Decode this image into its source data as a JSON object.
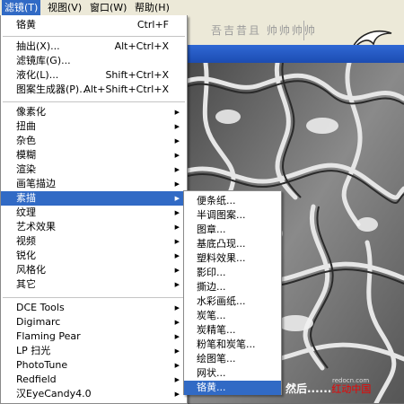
{
  "menubar": {
    "items": [
      {
        "label": "滤镜(T)",
        "active": true
      },
      {
        "label": "视图(V)",
        "active": false
      },
      {
        "label": "窗口(W)",
        "active": false
      },
      {
        "label": "帮助(H)",
        "active": false
      }
    ]
  },
  "toolbar": {
    "glyphs": "吾吉昔且 帅帅帅帅"
  },
  "filter_menu": {
    "top": [
      {
        "label": "铬黄",
        "shortcut": "Ctrl+F"
      }
    ],
    "group1": [
      {
        "label": "抽出(X)...",
        "shortcut": "Alt+Ctrl+X"
      },
      {
        "label": "滤镜库(G)...",
        "shortcut": ""
      },
      {
        "label": "液化(L)...",
        "shortcut": "Shift+Ctrl+X"
      },
      {
        "label": "图案生成器(P)...",
        "shortcut": "Alt+Shift+Ctrl+X"
      }
    ],
    "group2": [
      {
        "label": "像素化"
      },
      {
        "label": "扭曲"
      },
      {
        "label": "杂色"
      },
      {
        "label": "模糊"
      },
      {
        "label": "渲染"
      },
      {
        "label": "画笔描边"
      },
      {
        "label": "素描",
        "highlighted": true
      },
      {
        "label": "纹理"
      },
      {
        "label": "艺术效果"
      },
      {
        "label": "视频"
      },
      {
        "label": "锐化"
      },
      {
        "label": "风格化"
      },
      {
        "label": "其它"
      }
    ],
    "group3": [
      {
        "label": "DCE Tools"
      },
      {
        "label": "Digimarc"
      },
      {
        "label": "Flaming Pear"
      },
      {
        "label": "LP 扫光"
      },
      {
        "label": "PhotoTune"
      },
      {
        "label": "Redfield"
      },
      {
        "label": "汉EyeCandy4.0"
      }
    ]
  },
  "sketch_menu": {
    "items": [
      {
        "label": "便条纸..."
      },
      {
        "label": "半调图案..."
      },
      {
        "label": "图章..."
      },
      {
        "label": "基底凸现..."
      },
      {
        "label": "塑料效果..."
      },
      {
        "label": "影印..."
      },
      {
        "label": "撕边..."
      },
      {
        "label": "水彩画纸..."
      },
      {
        "label": "炭笔..."
      },
      {
        "label": "炭精笔..."
      },
      {
        "label": "粉笔和炭笔..."
      },
      {
        "label": "绘图笔..."
      },
      {
        "label": "网状..."
      },
      {
        "label": "铬黄...",
        "highlighted": true
      }
    ]
  },
  "watermark": {
    "text": "然后......",
    "site": "红动中国",
    "small": "redocn.com"
  }
}
